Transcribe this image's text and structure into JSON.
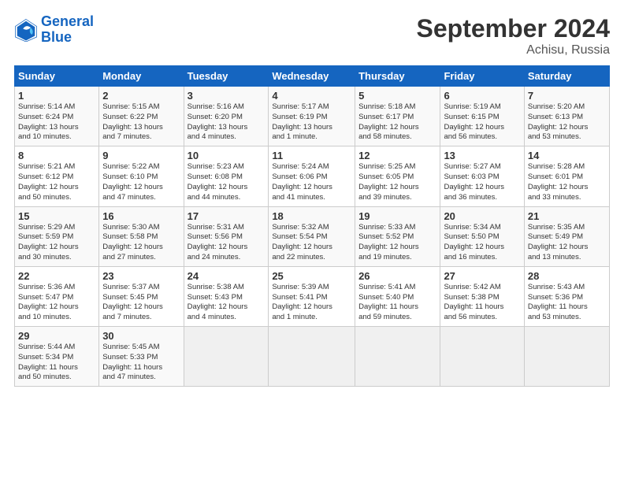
{
  "logo": {
    "line1": "General",
    "line2": "Blue"
  },
  "title": "September 2024",
  "subtitle": "Achisu, Russia",
  "days_of_week": [
    "Sunday",
    "Monday",
    "Tuesday",
    "Wednesday",
    "Thursday",
    "Friday",
    "Saturday"
  ],
  "weeks": [
    [
      {
        "num": "1",
        "detail": "Sunrise: 5:14 AM\nSunset: 6:24 PM\nDaylight: 13 hours\nand 10 minutes."
      },
      {
        "num": "2",
        "detail": "Sunrise: 5:15 AM\nSunset: 6:22 PM\nDaylight: 13 hours\nand 7 minutes."
      },
      {
        "num": "3",
        "detail": "Sunrise: 5:16 AM\nSunset: 6:20 PM\nDaylight: 13 hours\nand 4 minutes."
      },
      {
        "num": "4",
        "detail": "Sunrise: 5:17 AM\nSunset: 6:19 PM\nDaylight: 13 hours\nand 1 minute."
      },
      {
        "num": "5",
        "detail": "Sunrise: 5:18 AM\nSunset: 6:17 PM\nDaylight: 12 hours\nand 58 minutes."
      },
      {
        "num": "6",
        "detail": "Sunrise: 5:19 AM\nSunset: 6:15 PM\nDaylight: 12 hours\nand 56 minutes."
      },
      {
        "num": "7",
        "detail": "Sunrise: 5:20 AM\nSunset: 6:13 PM\nDaylight: 12 hours\nand 53 minutes."
      }
    ],
    [
      {
        "num": "8",
        "detail": "Sunrise: 5:21 AM\nSunset: 6:12 PM\nDaylight: 12 hours\nand 50 minutes."
      },
      {
        "num": "9",
        "detail": "Sunrise: 5:22 AM\nSunset: 6:10 PM\nDaylight: 12 hours\nand 47 minutes."
      },
      {
        "num": "10",
        "detail": "Sunrise: 5:23 AM\nSunset: 6:08 PM\nDaylight: 12 hours\nand 44 minutes."
      },
      {
        "num": "11",
        "detail": "Sunrise: 5:24 AM\nSunset: 6:06 PM\nDaylight: 12 hours\nand 41 minutes."
      },
      {
        "num": "12",
        "detail": "Sunrise: 5:25 AM\nSunset: 6:05 PM\nDaylight: 12 hours\nand 39 minutes."
      },
      {
        "num": "13",
        "detail": "Sunrise: 5:27 AM\nSunset: 6:03 PM\nDaylight: 12 hours\nand 36 minutes."
      },
      {
        "num": "14",
        "detail": "Sunrise: 5:28 AM\nSunset: 6:01 PM\nDaylight: 12 hours\nand 33 minutes."
      }
    ],
    [
      {
        "num": "15",
        "detail": "Sunrise: 5:29 AM\nSunset: 5:59 PM\nDaylight: 12 hours\nand 30 minutes."
      },
      {
        "num": "16",
        "detail": "Sunrise: 5:30 AM\nSunset: 5:58 PM\nDaylight: 12 hours\nand 27 minutes."
      },
      {
        "num": "17",
        "detail": "Sunrise: 5:31 AM\nSunset: 5:56 PM\nDaylight: 12 hours\nand 24 minutes."
      },
      {
        "num": "18",
        "detail": "Sunrise: 5:32 AM\nSunset: 5:54 PM\nDaylight: 12 hours\nand 22 minutes."
      },
      {
        "num": "19",
        "detail": "Sunrise: 5:33 AM\nSunset: 5:52 PM\nDaylight: 12 hours\nand 19 minutes."
      },
      {
        "num": "20",
        "detail": "Sunrise: 5:34 AM\nSunset: 5:50 PM\nDaylight: 12 hours\nand 16 minutes."
      },
      {
        "num": "21",
        "detail": "Sunrise: 5:35 AM\nSunset: 5:49 PM\nDaylight: 12 hours\nand 13 minutes."
      }
    ],
    [
      {
        "num": "22",
        "detail": "Sunrise: 5:36 AM\nSunset: 5:47 PM\nDaylight: 12 hours\nand 10 minutes."
      },
      {
        "num": "23",
        "detail": "Sunrise: 5:37 AM\nSunset: 5:45 PM\nDaylight: 12 hours\nand 7 minutes."
      },
      {
        "num": "24",
        "detail": "Sunrise: 5:38 AM\nSunset: 5:43 PM\nDaylight: 12 hours\nand 4 minutes."
      },
      {
        "num": "25",
        "detail": "Sunrise: 5:39 AM\nSunset: 5:41 PM\nDaylight: 12 hours\nand 1 minute."
      },
      {
        "num": "26",
        "detail": "Sunrise: 5:41 AM\nSunset: 5:40 PM\nDaylight: 11 hours\nand 59 minutes."
      },
      {
        "num": "27",
        "detail": "Sunrise: 5:42 AM\nSunset: 5:38 PM\nDaylight: 11 hours\nand 56 minutes."
      },
      {
        "num": "28",
        "detail": "Sunrise: 5:43 AM\nSunset: 5:36 PM\nDaylight: 11 hours\nand 53 minutes."
      }
    ],
    [
      {
        "num": "29",
        "detail": "Sunrise: 5:44 AM\nSunset: 5:34 PM\nDaylight: 11 hours\nand 50 minutes."
      },
      {
        "num": "30",
        "detail": "Sunrise: 5:45 AM\nSunset: 5:33 PM\nDaylight: 11 hours\nand 47 minutes."
      },
      {
        "num": "",
        "detail": ""
      },
      {
        "num": "",
        "detail": ""
      },
      {
        "num": "",
        "detail": ""
      },
      {
        "num": "",
        "detail": ""
      },
      {
        "num": "",
        "detail": ""
      }
    ]
  ]
}
